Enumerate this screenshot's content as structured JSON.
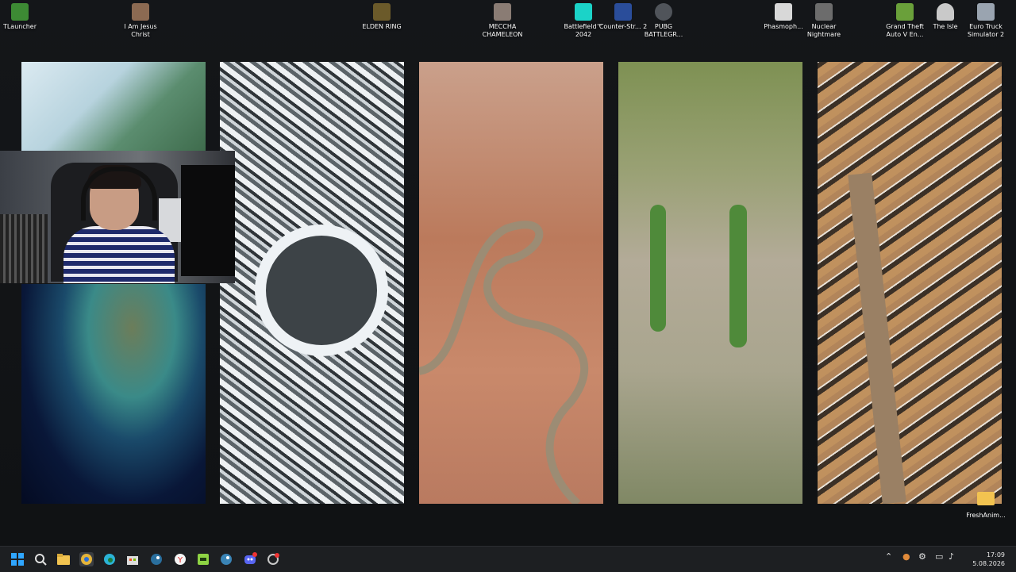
{
  "desktop_icons": [
    {
      "label": "TLauncher",
      "icon": "tlauncher-icon",
      "color": "#3d8a34"
    },
    {
      "label": "I Am Jesus Christ",
      "icon": "jesus-game-icon",
      "color": "#8c6a52"
    },
    {
      "label": "ELDEN RING",
      "icon": "elden-ring-icon",
      "color": "#6b5a2a"
    },
    {
      "label": "MECCHA CHAMELEON",
      "icon": "meccha-chameleon-icon",
      "color": "#8a7c74"
    },
    {
      "label": "Battlefield™ 2042",
      "icon": "battlefield-icon",
      "color": "#1bd3c8"
    },
    {
      "label": "Counter-Str... 2",
      "icon": "counter-strike-icon",
      "color": "#2a4d9a"
    },
    {
      "label": "PUBG BATTLEGR...",
      "icon": "pubg-icon",
      "color": "#50545a"
    },
    {
      "label": "Phasmoph...",
      "icon": "phasmophobia-icon",
      "color": "#d8d8d8"
    },
    {
      "label": "Nuclear Nightmare",
      "icon": "nuclear-nightmare-icon",
      "color": "#6c6c6c"
    },
    {
      "label": "Grand Theft Auto V En...",
      "icon": "gta-v-icon",
      "color": "#6aa03a"
    },
    {
      "label": "The Isle",
      "icon": "the-isle-icon",
      "color": "#c9c9c9"
    },
    {
      "label": "Euro Truck Simulator 2",
      "icon": "euro-truck-icon",
      "color": "#9aa4b0"
    }
  ],
  "desktop_folder": {
    "label": "FreshAnim...",
    "icon": "folder-icon"
  },
  "wallpaper_panels": [
    {
      "name": "coastline-panel",
      "colors": [
        "#cfe4ee",
        "#3d6b5d",
        "#0b1b3a"
      ]
    },
    {
      "name": "crater-lake-panel",
      "colors": [
        "#e9edf0",
        "#4d5459",
        "#d7dde1"
      ]
    },
    {
      "name": "desert-river-panel",
      "colors": [
        "#c88a6f",
        "#9b5843",
        "#cc9274"
      ]
    },
    {
      "name": "green-plain-panel",
      "colors": [
        "#7f8f4c",
        "#a9a38d",
        "#7e8260"
      ]
    },
    {
      "name": "mountain-valley-panel",
      "colors": [
        "#b98b58",
        "#3d3328",
        "#b6895a"
      ]
    }
  ],
  "taskbar": {
    "apps": [
      {
        "name": "start-button",
        "icon": "windows-logo-icon",
        "color": "#2fa6ff"
      },
      {
        "name": "search-button",
        "icon": "search-icon",
        "color": "#e0e0e0"
      },
      {
        "name": "file-explorer-button",
        "icon": "folder-icon",
        "color": "#f2c350"
      },
      {
        "name": "chrome-button",
        "icon": "chrome-icon",
        "color": "#e4b43a"
      },
      {
        "name": "edge-button",
        "icon": "edge-icon",
        "color": "#2bb3d6"
      },
      {
        "name": "store-button",
        "icon": "store-icon",
        "color": "#dcdcdc"
      },
      {
        "name": "steam-button",
        "icon": "steam-icon",
        "color": "#2a6f9e"
      },
      {
        "name": "yandex-button",
        "icon": "yandex-icon",
        "color": "#f5f5f5"
      },
      {
        "name": "live-button",
        "icon": "live-app-icon",
        "color": "#8ed444"
      },
      {
        "name": "steam-2-button",
        "icon": "steam-icon",
        "color": "#3a84b6"
      },
      {
        "name": "discord-button",
        "icon": "discord-icon",
        "color": "#5865f2"
      },
      {
        "name": "recorder-button",
        "icon": "recorder-icon",
        "color": "#c9c9c9"
      }
    ],
    "tray_icons": [
      "chevron-up-icon",
      "microphone-icon",
      "network-icon",
      "display-icon",
      "speaker-icon",
      "battery-icon"
    ],
    "time": "17:09",
    "date": "5.08.2026"
  }
}
